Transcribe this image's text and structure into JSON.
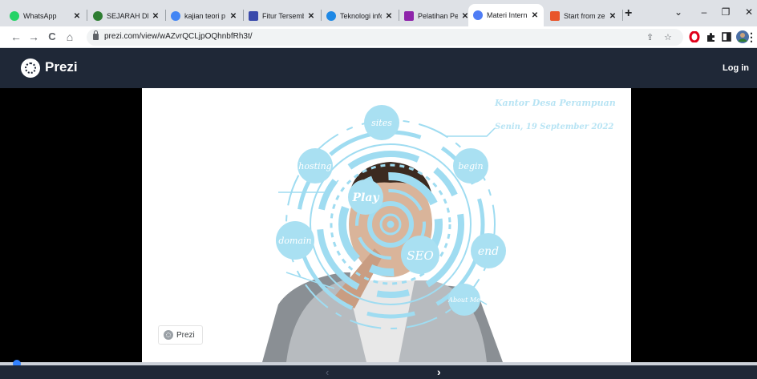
{
  "browser": {
    "tabs": [
      {
        "title": "WhatsApp",
        "favicon_color": "#25d366",
        "favicon": "whatsapp-icon"
      },
      {
        "title": "SEJARAH DE",
        "favicon_color": "#2e7d32",
        "favicon": "site-icon"
      },
      {
        "title": "kajian teori p",
        "favicon_color": "#4285f4",
        "favicon": "google-icon"
      },
      {
        "title": "Fitur Tersemb",
        "favicon_color": "#3949ab",
        "favicon": "site-icon"
      },
      {
        "title": "Teknologi infc",
        "favicon_color": "#1e88e5",
        "favicon": "site-icon"
      },
      {
        "title": "Pelatihan Per",
        "favicon_color": "#8e24aa",
        "favicon": "site-icon"
      },
      {
        "title": "Materi Intern",
        "favicon_color": "#4f7df5",
        "favicon": "prezi-icon",
        "active": true
      },
      {
        "title": "Start from zei",
        "favicon_color": "#e8552b",
        "favicon": "site-icon"
      }
    ],
    "new_tab": "+",
    "window": {
      "collapse": "⌄",
      "minimize": "–",
      "restore": "❐",
      "close": "✕"
    },
    "nav": {
      "back": "←",
      "forward": "→",
      "reload": "C",
      "home": "⌂"
    },
    "url": "prezi.com/view/wAZvrQCLjpOQhnbfRh3t/",
    "omnibox_icons": {
      "share": "⇪",
      "star": "☆"
    },
    "extensions": [
      "opera-icon",
      "puzzle-icon",
      "sidepanel-icon",
      "profile-avatar"
    ],
    "menu": "⋮"
  },
  "prezi": {
    "brand": "Prezi",
    "login": "Log in",
    "slide": {
      "line1": "Kantor Desa Perampuan",
      "line2": "Senin, 19 September 2022",
      "bubbles": [
        "sites",
        "hosting",
        "begin",
        "Play",
        "domain",
        "SEO",
        "end",
        "About Me"
      ],
      "watermark": "Prezi"
    },
    "nav": {
      "prev": "‹",
      "next": "›"
    },
    "progress": 0.01
  }
}
